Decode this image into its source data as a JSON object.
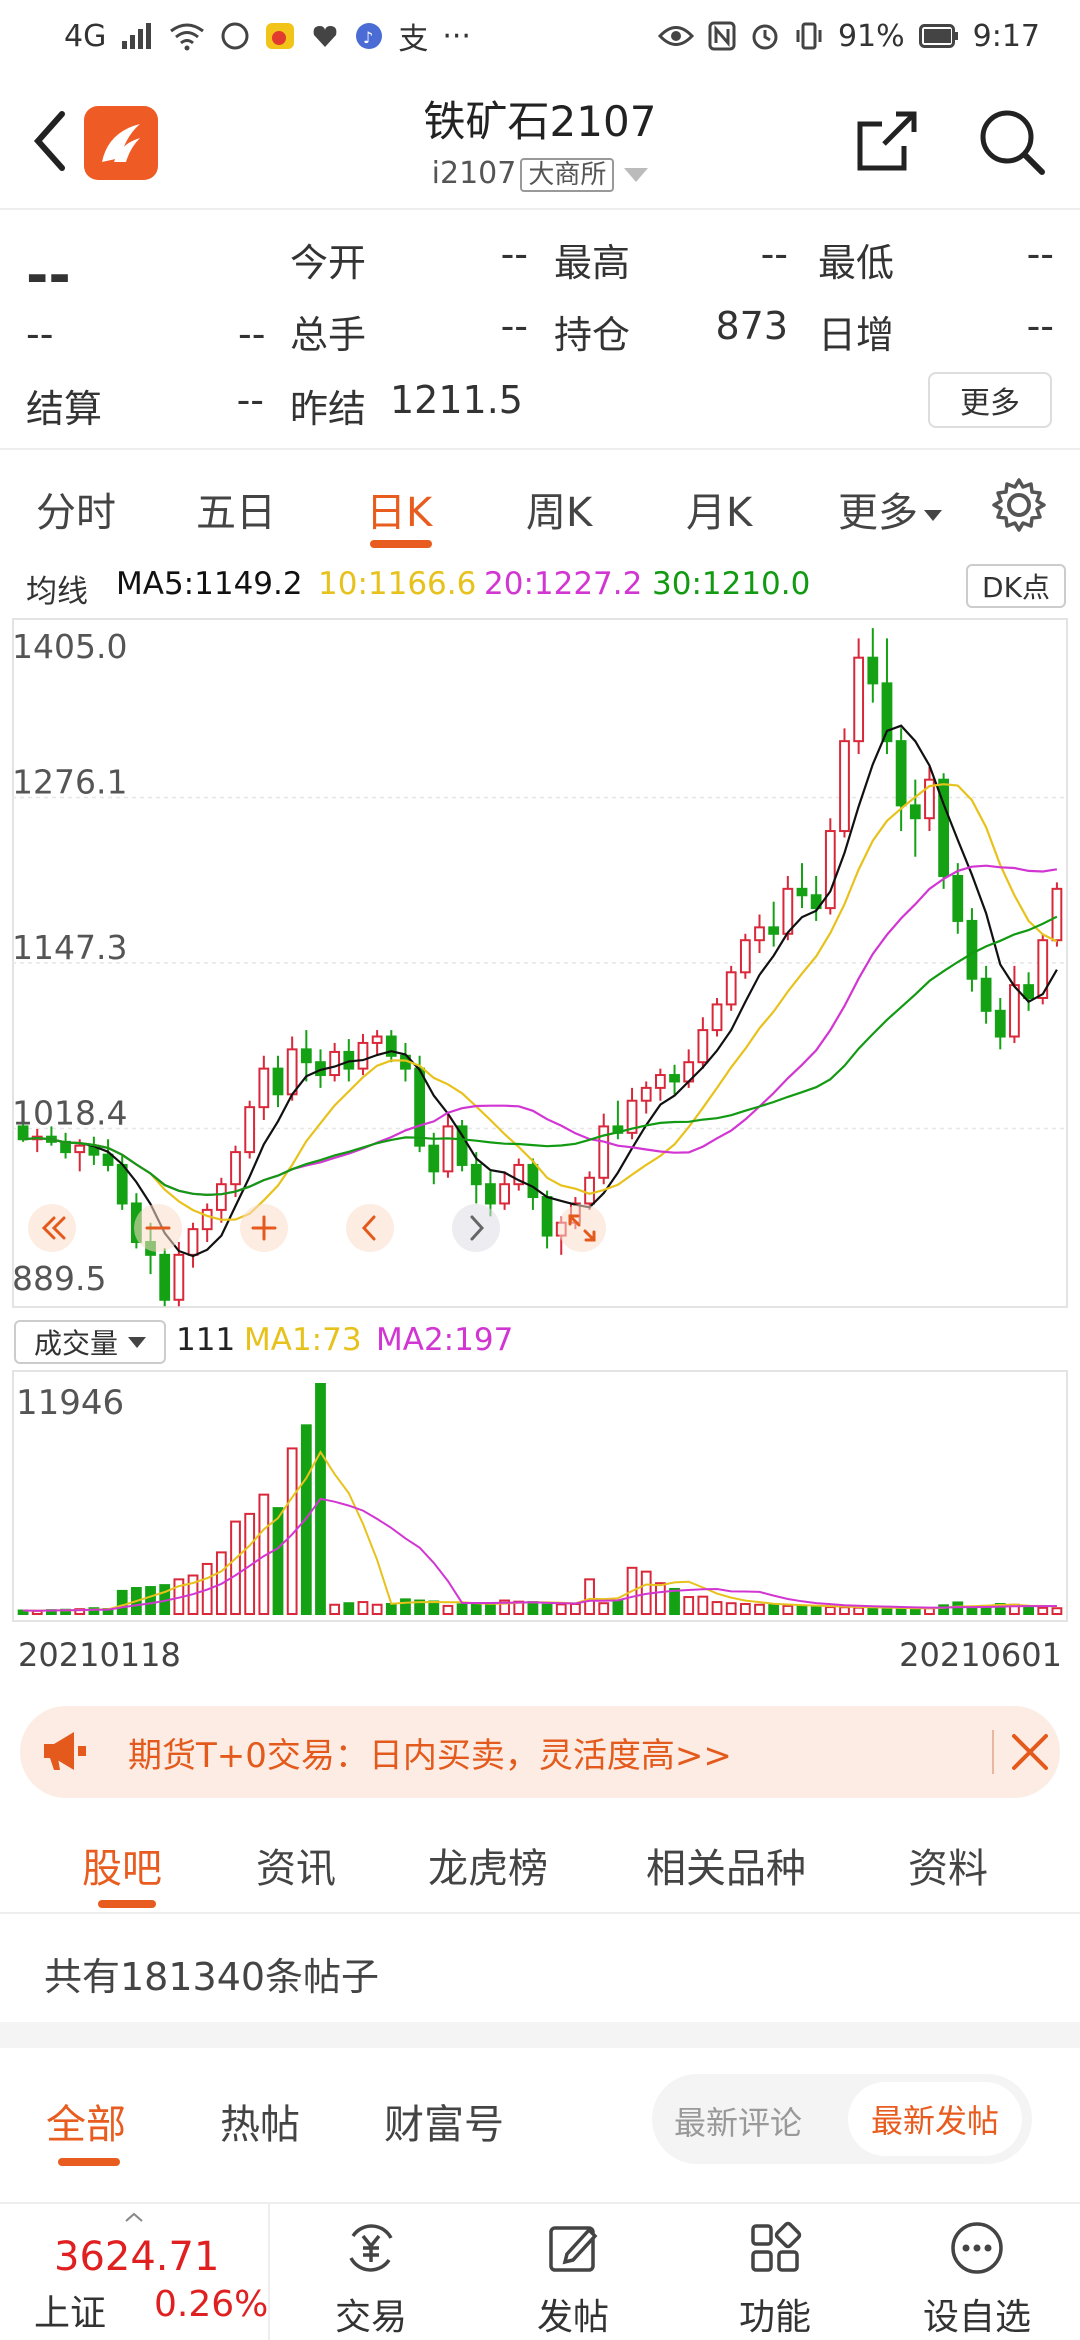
{
  "status_bar": {
    "network": "4G",
    "battery": "91%",
    "time": "9:17",
    "app_icons": [
      "message-icon",
      "weibo-icon",
      "health-icon",
      "music-icon",
      "alipay-icon",
      "more-icon"
    ]
  },
  "header": {
    "title": "铁矿石2107",
    "code": "i2107",
    "exchange": "大商所"
  },
  "quote": {
    "price": "--",
    "change": "--",
    "change_pct": "--",
    "items": [
      {
        "label": "今开",
        "value": "--"
      },
      {
        "label": "最高",
        "value": "--"
      },
      {
        "label": "最低",
        "value": "--"
      },
      {
        "label": "总手",
        "value": "--"
      },
      {
        "label": "持仓",
        "value": "873"
      },
      {
        "label": "日增",
        "value": "--"
      },
      {
        "label": "结算",
        "value": "--"
      },
      {
        "label": "昨结",
        "value": "1211.5"
      }
    ],
    "more_label": "更多"
  },
  "kline_tabs": {
    "tabs": [
      "分时",
      "五日",
      "日K",
      "周K",
      "月K",
      "更多"
    ],
    "active": 2
  },
  "ma_legend": {
    "label": "均线",
    "ma5": "MA5:1149.2",
    "ma10": "10:1166.6",
    "ma20": "20:1227.2",
    "ma30": "30:1210.0",
    "dk_label": "DK点"
  },
  "colors": {
    "accent": "#e85d1f",
    "up": "#d8283a",
    "down": "#14a214",
    "ma5": "#111111",
    "ma10": "#e8c21c",
    "ma20": "#d236d2",
    "ma30": "#129a12"
  },
  "chart_data": {
    "type": "candlestick",
    "y_ticks": [
      "1405.0",
      "1276.1",
      "1147.3",
      "1018.4",
      "889.5"
    ],
    "ylim": [
      889.5,
      1405.0
    ],
    "candles": [
      [
        1020,
        1028,
        1008,
        1010
      ],
      [
        1010,
        1018,
        1000,
        1012
      ],
      [
        1012,
        1020,
        1005,
        1008
      ],
      [
        1008,
        1015,
        995,
        1000
      ],
      [
        1000,
        1010,
        985,
        1005
      ],
      [
        1005,
        1012,
        990,
        998
      ],
      [
        998,
        1010,
        985,
        990
      ],
      [
        990,
        998,
        955,
        960
      ],
      [
        960,
        968,
        925,
        930
      ],
      [
        930,
        945,
        905,
        920
      ],
      [
        920,
        925,
        880,
        885
      ],
      [
        885,
        930,
        880,
        920
      ],
      [
        920,
        945,
        910,
        940
      ],
      [
        940,
        960,
        930,
        955
      ],
      [
        955,
        980,
        945,
        975
      ],
      [
        975,
        1005,
        965,
        1000
      ],
      [
        1000,
        1040,
        995,
        1035
      ],
      [
        1035,
        1075,
        1025,
        1065
      ],
      [
        1065,
        1075,
        1035,
        1045
      ],
      [
        1045,
        1090,
        1040,
        1080
      ],
      [
        1080,
        1095,
        1055,
        1070
      ],
      [
        1070,
        1080,
        1050,
        1060
      ],
      [
        1060,
        1085,
        1055,
        1078
      ],
      [
        1078,
        1088,
        1055,
        1065
      ],
      [
        1065,
        1092,
        1060,
        1085
      ],
      [
        1085,
        1095,
        1075,
        1090
      ],
      [
        1090,
        1095,
        1070,
        1075
      ],
      [
        1075,
        1085,
        1055,
        1065
      ],
      [
        1065,
        1075,
        1000,
        1005
      ],
      [
        1005,
        1015,
        975,
        985
      ],
      [
        985,
        1030,
        980,
        1020
      ],
      [
        1020,
        1025,
        985,
        990
      ],
      [
        990,
        1000,
        960,
        975
      ],
      [
        975,
        985,
        950,
        960
      ],
      [
        960,
        985,
        955,
        975
      ],
      [
        975,
        995,
        970,
        990
      ],
      [
        990,
        995,
        955,
        965
      ],
      [
        965,
        970,
        925,
        935
      ],
      [
        935,
        950,
        920,
        945
      ],
      [
        945,
        965,
        940,
        960
      ],
      [
        960,
        985,
        955,
        980
      ],
      [
        980,
        1030,
        975,
        1020
      ],
      [
        1020,
        1040,
        1010,
        1015
      ],
      [
        1015,
        1050,
        1010,
        1040
      ],
      [
        1040,
        1055,
        1030,
        1050
      ],
      [
        1050,
        1065,
        1040,
        1060
      ],
      [
        1060,
        1068,
        1045,
        1055
      ],
      [
        1055,
        1080,
        1050,
        1070
      ],
      [
        1070,
        1105,
        1065,
        1095
      ],
      [
        1095,
        1120,
        1090,
        1115
      ],
      [
        1115,
        1145,
        1110,
        1140
      ],
      [
        1140,
        1170,
        1135,
        1165
      ],
      [
        1165,
        1185,
        1155,
        1175
      ],
      [
        1175,
        1195,
        1160,
        1170
      ],
      [
        1170,
        1215,
        1165,
        1205
      ],
      [
        1205,
        1225,
        1190,
        1200
      ],
      [
        1200,
        1215,
        1180,
        1190
      ],
      [
        1190,
        1260,
        1185,
        1250
      ],
      [
        1250,
        1330,
        1245,
        1320
      ],
      [
        1320,
        1400,
        1310,
        1385
      ],
      [
        1385,
        1408,
        1350,
        1365
      ],
      [
        1365,
        1400,
        1310,
        1320
      ],
      [
        1320,
        1330,
        1250,
        1270
      ],
      [
        1270,
        1290,
        1230,
        1260
      ],
      [
        1260,
        1300,
        1250,
        1290
      ],
      [
        1290,
        1295,
        1205,
        1215
      ],
      [
        1215,
        1225,
        1170,
        1180
      ],
      [
        1180,
        1190,
        1125,
        1135
      ],
      [
        1135,
        1145,
        1100,
        1110
      ],
      [
        1110,
        1120,
        1080,
        1090
      ],
      [
        1090,
        1145,
        1085,
        1130
      ],
      [
        1130,
        1140,
        1110,
        1120
      ],
      [
        1120,
        1170,
        1115,
        1165
      ],
      [
        1165,
        1210,
        1160,
        1205
      ]
    ],
    "volume": {
      "label": "成交量",
      "value": "111",
      "ma1": "MA1:73",
      "ma2": "MA2:197",
      "ymax_label": "11946",
      "ymax": 11946,
      "bars": [
        180,
        160,
        200,
        220,
        250,
        300,
        260,
        1200,
        1350,
        1400,
        1500,
        1800,
        2000,
        2600,
        3200,
        4800,
        5200,
        6200,
        5500,
        8600,
        9800,
        11946,
        480,
        560,
        620,
        480,
        520,
        760,
        700,
        650,
        420,
        500,
        520,
        560,
        700,
        640,
        620,
        480,
        500,
        520,
        1800,
        560,
        700,
        2400,
        2200,
        1600,
        1300,
        880,
        900,
        620,
        560,
        520,
        480,
        500,
        420,
        400,
        380,
        360,
        350,
        330,
        310,
        300,
        290,
        280,
        300,
        450,
        600,
        380,
        420,
        520,
        480,
        360,
        320,
        300
      ],
      "start_date": "20210118",
      "end_date": "20210601"
    }
  },
  "chart_controls": [
    "double-left-icon",
    "zoom-out-icon",
    "zoom-in-icon",
    "left-icon",
    "right-icon",
    "expand-icon"
  ],
  "banner": {
    "text": "期货T+0交易：日内买卖，灵活度高>>"
  },
  "forum_tabs": {
    "tabs": [
      "股吧",
      "资讯",
      "龙虎榜",
      "相关品种",
      "资料"
    ],
    "active": 0
  },
  "post_count": "共有181340条帖子",
  "sub_tabs": {
    "tabs": [
      "全部",
      "热帖",
      "财富号"
    ],
    "active": 0,
    "sort_a": "最新评论",
    "sort_b": "最新发帖"
  },
  "bottom_bar": {
    "index_value": "3624.71",
    "index_name": "上证",
    "index_pct": "0.26%",
    "items": [
      "交易",
      "发帖",
      "功能",
      "设自选"
    ]
  }
}
